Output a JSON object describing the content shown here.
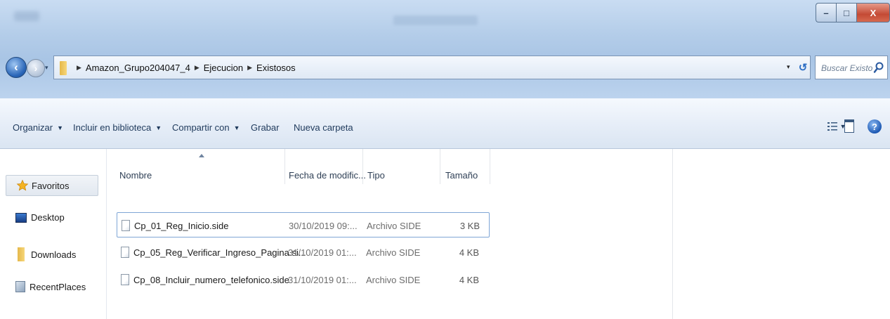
{
  "window": {
    "minimize_glyph": "–",
    "maximize_glyph": "□",
    "close_glyph": "X"
  },
  "address": {
    "crumbs": [
      "Amazon_Grupo204047_4",
      "Ejecucion",
      "Existosos"
    ],
    "back_glyph": "‹",
    "forward_glyph": "›",
    "dropdown_glyph": "▾",
    "refresh_glyph": "↺"
  },
  "search": {
    "placeholder": "Buscar Existo..."
  },
  "toolbar": {
    "organize": "Organizar",
    "include_library": "Incluir en biblioteca",
    "share_with": "Compartir con",
    "burn": "Grabar",
    "new_folder": "Nueva carpeta",
    "caret": "▼",
    "help_glyph": "?"
  },
  "nav": {
    "favorites": "Favoritos",
    "items": [
      "Desktop",
      "Downloads",
      "RecentPlaces"
    ]
  },
  "columns": {
    "name": "Nombre",
    "date": "Fecha de modific...",
    "type": "Tipo",
    "size": "Tamaño"
  },
  "files": [
    {
      "name": "Cp_01_Reg_Inicio.side",
      "date": "30/10/2019 09:...",
      "type": "Archivo SIDE",
      "size": "3 KB"
    },
    {
      "name": "Cp_05_Reg_Verificar_Ingreso_Pagina.si...",
      "date": "31/10/2019 01:...",
      "type": "Archivo SIDE",
      "size": "4 KB"
    },
    {
      "name": "Cp_08_Incluir_numero_telefonico.side",
      "date": "31/10/2019 01:...",
      "type": "Archivo SIDE",
      "size": "4 KB"
    }
  ],
  "colors": {
    "titlebar": "#b4cde9",
    "toolbar_text": "#1e395b",
    "selection_border": "#7fa6d6",
    "close_button": "#c44a35"
  },
  "icons": {
    "back": "back-arrow-icon",
    "forward": "forward-arrow-icon",
    "folder": "folder-icon",
    "refresh": "refresh-icon",
    "search": "search-icon",
    "favorites": "star-icon",
    "desktop": "desktop-icon",
    "downloads": "folder-icon",
    "recent": "recent-places-icon",
    "file": "file-icon",
    "view": "view-options-icon",
    "pane": "preview-pane-icon",
    "help": "help-icon"
  }
}
